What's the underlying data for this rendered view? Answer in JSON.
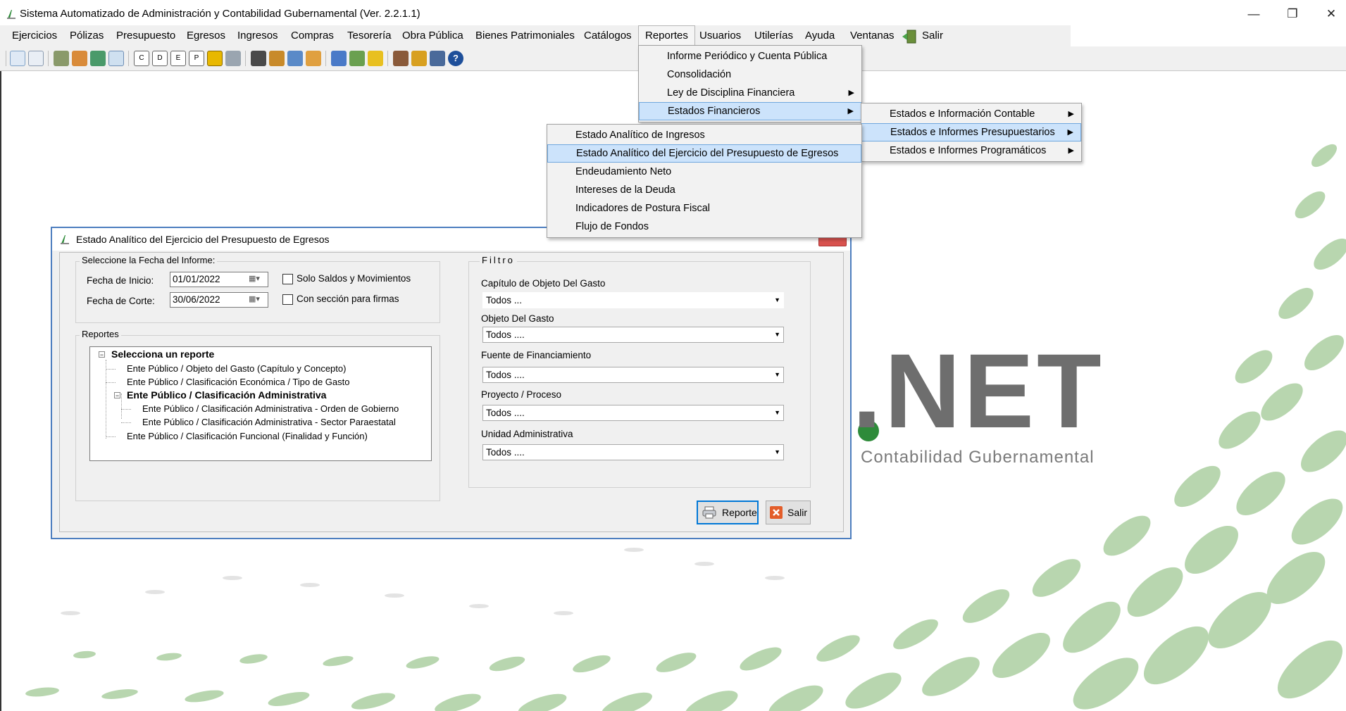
{
  "window": {
    "title": "Sistema Automatizado de Administración y Contabilidad Gubernamental  (Ver. 2.2.1.1)",
    "minimize": "—",
    "restore": "❐",
    "close": "✕"
  },
  "menubar": {
    "items": [
      {
        "label": "Ejercicios"
      },
      {
        "label": "Pólizas"
      },
      {
        "label": "Presupuesto"
      },
      {
        "label": "Egresos"
      },
      {
        "label": "Ingresos"
      },
      {
        "label": "Compras"
      },
      {
        "label": "Tesorería"
      },
      {
        "label": "Obra Pública"
      },
      {
        "label": "Bienes Patrimoniales"
      },
      {
        "label": "Catálogos"
      },
      {
        "label": "Reportes"
      },
      {
        "label": "Usuarios"
      },
      {
        "label": "Utilerías"
      },
      {
        "label": "Ayuda"
      },
      {
        "label": "Ventanas"
      },
      {
        "label": "Salir"
      }
    ]
  },
  "reportes_menu": {
    "items": [
      {
        "label": "Informe Periódico y Cuenta Pública"
      },
      {
        "label": "Consolidación"
      },
      {
        "label": "Ley de Disciplina Financiera"
      },
      {
        "label": "Estados Financieros"
      }
    ]
  },
  "estados_financieros_menu": {
    "items": [
      {
        "label": "Estados e Información Contable"
      },
      {
        "label": "Estados e Informes Presupuestarios"
      },
      {
        "label": "Estados e Informes Programáticos"
      }
    ]
  },
  "presupuestarios_menu": {
    "items": [
      {
        "label": "Estado Analítico de Ingresos"
      },
      {
        "label": "Estado Analítico del Ejercicio del Presupuesto de Egresos"
      },
      {
        "label": "Endeudamiento Neto"
      },
      {
        "label": "Intereses de la Deuda"
      },
      {
        "label": "Indicadores de Postura Fiscal"
      },
      {
        "label": "Flujo de Fondos"
      }
    ]
  },
  "background": {
    "logo_text": ".NET",
    "tagline": "Contabilidad Gubernamental",
    "accent_color": "#7fb56e",
    "logo_color": "#6e6e6e"
  },
  "dialog": {
    "title": "Estado Analítico del Ejercicio del Presupuesto de Egresos",
    "fecha_group": {
      "label": "Seleccione la Fecha del Informe:",
      "inicio_label": "Fecha de Inicio:",
      "inicio_value": "01/01/2022",
      "corte_label": "Fecha de Corte:",
      "corte_value": "30/06/2022",
      "solo_saldos": "Solo Saldos y Movimientos",
      "seccion_firmas": "Con sección para firmas"
    },
    "reportes_group": {
      "label": "Reportes",
      "tree": [
        {
          "label": "Selecciona un reporte"
        },
        {
          "label": "Ente Público / Objeto del Gasto (Capítulo y Concepto)"
        },
        {
          "label": "Ente Público / Clasificación Económica / Tipo de Gasto"
        },
        {
          "label": "Ente Público /  Clasificación Administrativa"
        },
        {
          "label": "Ente Público / Clasificación Administrativa - Orden de Gobierno"
        },
        {
          "label": "Ente Público / Clasificación Administrativa - Sector Paraestatal"
        },
        {
          "label": "Ente Público / Clasificación Funcional (Finalidad y Función)"
        }
      ]
    },
    "filtro_group": {
      "label": "Filtro",
      "capitulo_label": "Capítulo de Objeto Del Gasto",
      "capitulo_value": "Todos ...",
      "objeto_label": "Objeto Del Gasto",
      "objeto_value": "Todos ....",
      "fuente_label": "Fuente de Financiamiento",
      "fuente_value": "Todos ....",
      "proyecto_label": "Proyecto / Proceso",
      "proyecto_value": "Todos ....",
      "unidad_label": "Unidad Administrativa",
      "unidad_value": "Todos ...."
    },
    "buttons": {
      "reporte": "Reporte",
      "salir": "Salir"
    }
  }
}
